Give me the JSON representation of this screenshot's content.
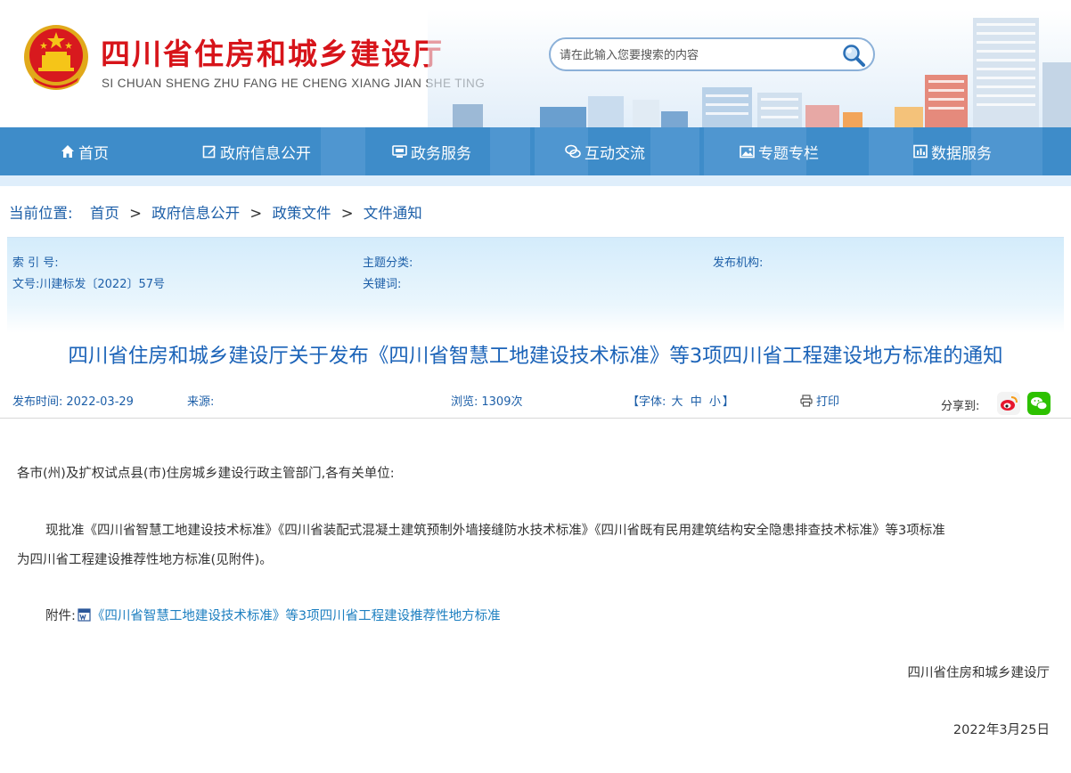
{
  "header": {
    "title": "四川省住房和城乡建设厅",
    "pinyin": "SI CHUAN SHENG ZHU FANG HE CHENG XIANG JIAN SHE TING",
    "search_placeholder": "请在此输入您要搜索的内容",
    "emblem_icon": "national-emblem-icon",
    "search_icon": "magnifier-icon"
  },
  "nav": {
    "items": [
      {
        "label": "首页",
        "icon": "home-icon"
      },
      {
        "label": "政府信息公开",
        "icon": "edit-icon"
      },
      {
        "label": "政务服务",
        "icon": "monitor-icon"
      },
      {
        "label": "互动交流",
        "icon": "chat-icon"
      },
      {
        "label": "专题专栏",
        "icon": "image-icon"
      },
      {
        "label": "数据服务",
        "icon": "chart-icon"
      }
    ]
  },
  "breadcrumb": {
    "label": "当前位置:",
    "items": [
      "首页",
      "政府信息公开",
      "政策文件",
      "文件通知"
    ],
    "separator": ">"
  },
  "meta": {
    "index_label": "索 引 号:",
    "index_value": "",
    "topic_label": "主题分类:",
    "topic_value": "",
    "publisher_label": "发布机构:",
    "publisher_value": "",
    "docno_label": "文号:",
    "docno_value": "川建标发〔2022〕57号",
    "keywords_label": "关键词:",
    "keywords_value": ""
  },
  "article": {
    "title": "四川省住房和城乡建设厅关于发布《四川省智慧工地建设技术标准》等3项四川省工程建设地方标准的通知",
    "publish_label": "发布时间:",
    "publish_date": "2022-03-29",
    "source_label": "来源:",
    "source_value": "",
    "views_label": "浏览:",
    "views_value": "1309次",
    "font_label": "【字体:",
    "font_large": "大",
    "font_medium": "中",
    "font_small": "小",
    "font_close": "】",
    "print_label": "打印",
    "share_label": "分享到:",
    "salutation": "各市(州)及扩权试点县(市)住房城乡建设行政主管部门,各有关单位:",
    "paragraph_line1": "现批准《四川省智慧工地建设技术标准》《四川省装配式混凝土建筑预制外墙接缝防水技术标准》《四川省既有民用建筑结构安全隐患排查技术标准》等3项标准",
    "paragraph_line2": "为四川省工程建设推荐性地方标准(见附件)。",
    "attachment_label": "附件:",
    "attachment_link": "《四川省智慧工地建设技术标准》等3项四川省工程建设推荐性地方标准",
    "signature": "四川省住房和城乡建设厅",
    "sign_date": "2022年3月25日"
  },
  "colors": {
    "brand_red": "#d7141a",
    "nav_blue": "#3e8cc9",
    "link_blue": "#1d5fa8",
    "title_blue": "#1b63b8"
  }
}
